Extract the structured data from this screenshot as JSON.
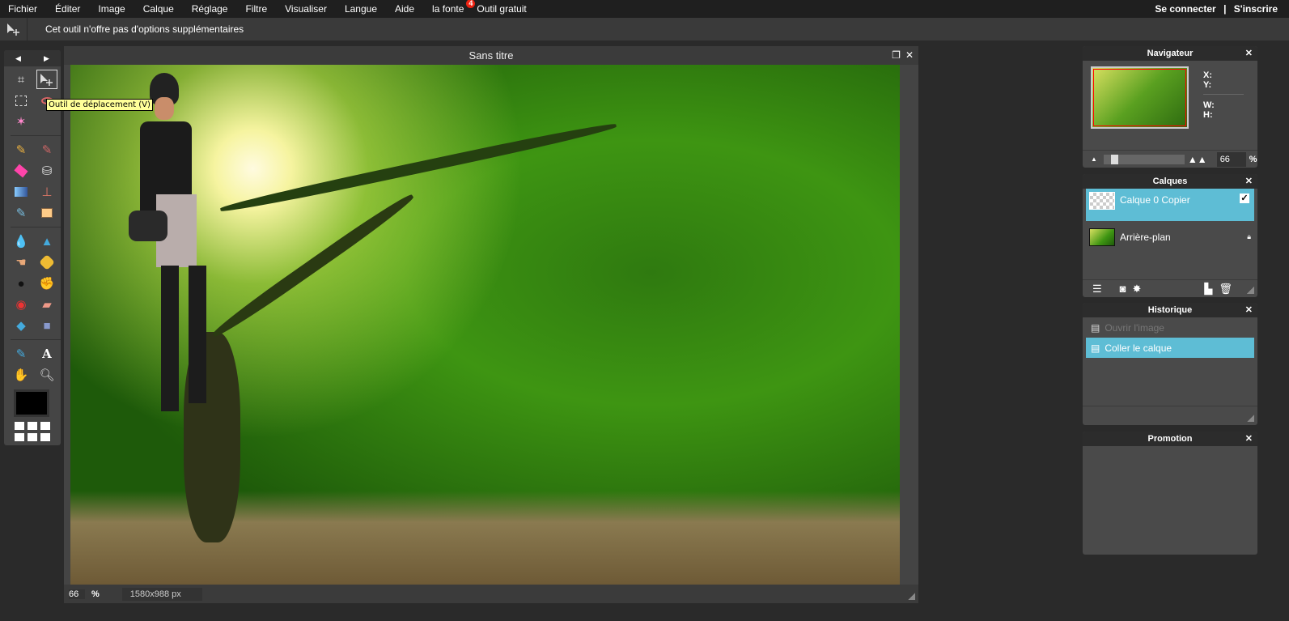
{
  "menubar": {
    "items": [
      "Fichier",
      "Éditer",
      "Image",
      "Calque",
      "Réglage",
      "Filtre",
      "Visualiser",
      "Langue",
      "Aide",
      "la fonte",
      "Outil gratuit"
    ],
    "badge": "4",
    "login": "Se connecter",
    "separator": "|",
    "signup": "S'inscrire"
  },
  "options": {
    "text": "Cet outil n'offre pas d'options supplémentaires"
  },
  "toolbox": {
    "tooltip": "Outil de déplacement (V)",
    "foreground_color": "#000000"
  },
  "document": {
    "title": "Sans titre",
    "zoom": "66",
    "pct": "%",
    "size": "1580x988 px"
  },
  "navigator": {
    "title": "Navigateur",
    "x": "X:",
    "y": "Y:",
    "w": "W:",
    "h": "H:",
    "zoom": "66",
    "pct": "%",
    "zoom_slider_percent": 10
  },
  "layers": {
    "title": "Calques",
    "items": [
      {
        "name": "Calque 0 Copier",
        "selected": true,
        "visible": true
      },
      {
        "name": "Arrière-plan",
        "locked": true
      }
    ]
  },
  "history": {
    "title": "Historique",
    "items": [
      "Ouvrir l'image",
      "Coller le calque"
    ]
  },
  "promotion": {
    "title": "Promotion"
  },
  "close": "✕",
  "colors": {
    "accent": "#5ebdd5",
    "tooltip": "#ffff99"
  }
}
